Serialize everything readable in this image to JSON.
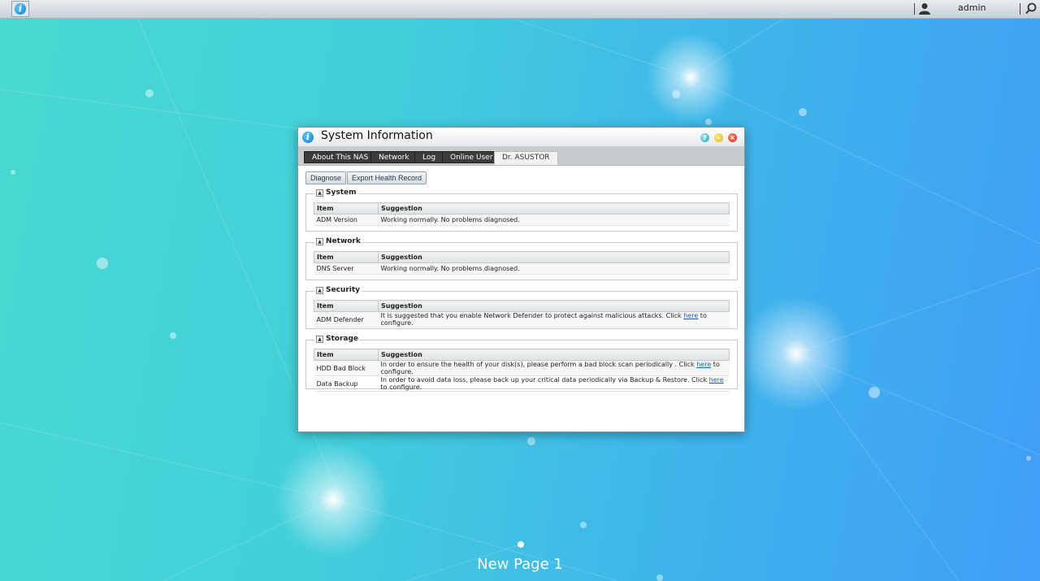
{
  "topbar": {
    "user": "admin"
  },
  "window": {
    "title": "System Information",
    "tabs": [
      {
        "label": "About This NAS"
      },
      {
        "label": "Network"
      },
      {
        "label": "Log"
      },
      {
        "label": "Online User"
      },
      {
        "label": "Dr. ASUSTOR",
        "active": true
      }
    ],
    "buttons": {
      "diagnose": "Diagnose",
      "export": "Export Health Record"
    },
    "headers": {
      "item": "Item",
      "suggestion": "Suggestion"
    },
    "sections": {
      "system": {
        "title": "System",
        "rows": [
          {
            "item": "ADM Version",
            "suggestion": "Working normally. No problems diagnosed."
          }
        ]
      },
      "network": {
        "title": "Network",
        "rows": [
          {
            "item": "DNS Server",
            "suggestion": "Working normally. No problems diagnosed."
          }
        ]
      },
      "security": {
        "title": "Security",
        "rows": [
          {
            "item": "ADM Defender",
            "pre": "It is suggested that you enable Network Defender to protect against malicious attacks. Click ",
            "link": "here",
            "post": " to configure."
          }
        ]
      },
      "storage": {
        "title": "Storage",
        "rows": [
          {
            "item": "HDD Bad Block",
            "pre": "In order to ensure the health of your disk(s), please perform a bad block scan periodically . Click ",
            "link": "here",
            "post": " to configure."
          },
          {
            "item": "Data Backup",
            "pre": "In order to avoid data loss, please back up your critical data periodically via Backup & Restore. Click ",
            "link": "here",
            "post": " to configure."
          }
        ]
      }
    }
  },
  "desktop": {
    "page_label": "New Page 1"
  },
  "colors": {
    "accent": "#1a5bc4",
    "tab_dark": "#3b3b3b",
    "bg_left": "#48d9d0",
    "bg_right": "#3f9ef7"
  },
  "icons": {
    "app": "info-icon",
    "user": "user-icon",
    "search": "search-icon",
    "help": "help-icon",
    "minimize": "minimize-icon",
    "close": "close-icon"
  }
}
